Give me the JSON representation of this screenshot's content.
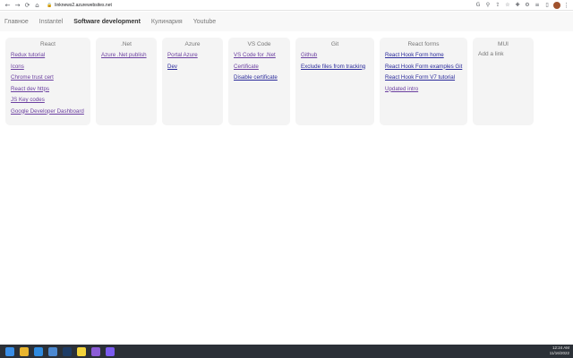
{
  "browser": {
    "url": "linknews2.azurewebsites.net",
    "nav": [
      "←",
      "→",
      "⟳",
      "⌂"
    ],
    "toolbar_icons": [
      {
        "name": "google-icon",
        "glyph": "G"
      },
      {
        "name": "search-icon",
        "glyph": "⚲"
      },
      {
        "name": "share-icon",
        "glyph": "⇪"
      },
      {
        "name": "star-icon",
        "glyph": "☆"
      },
      {
        "name": "extension-icon",
        "glyph": "✚"
      },
      {
        "name": "puzzle-icon",
        "glyph": "⚙"
      },
      {
        "name": "reading-list-icon",
        "glyph": "≡"
      },
      {
        "name": "sidebar-icon",
        "glyph": "▯"
      }
    ],
    "profile_color": "#a0522d"
  },
  "topnav": {
    "items": [
      "Главное",
      "Instantel",
      "Software development",
      "Кулинария",
      "Youtube"
    ],
    "active_index": 2
  },
  "cards": [
    {
      "title": "React",
      "width": 95,
      "links": [
        {
          "text": "Redux tutorial",
          "visited": true
        },
        {
          "text": "Icons",
          "visited": true
        },
        {
          "text": "Chrome trust cert",
          "visited": true
        },
        {
          "text": "React dev https",
          "visited": true
        },
        {
          "text": "JS Key codes",
          "visited": true
        },
        {
          "text": "Google Developer Dashboard",
          "visited": true
        }
      ]
    },
    {
      "title": ".Net",
      "width": 68,
      "links": [
        {
          "text": "Azure .Net publish",
          "visited": true
        }
      ]
    },
    {
      "title": "Azure",
      "width": 68,
      "links": [
        {
          "text": "Portal Azure",
          "visited": true
        },
        {
          "text": "Dev",
          "visited": false
        }
      ]
    },
    {
      "title": "VS Code",
      "width": 69,
      "links": [
        {
          "text": "VS Code for .Net",
          "visited": true
        },
        {
          "text": "Certificate",
          "visited": true
        },
        {
          "text": "Disable certificate",
          "visited": false
        }
      ]
    },
    {
      "title": "Git",
      "width": 88,
      "links": [
        {
          "text": "Github",
          "visited": true
        },
        {
          "text": "Exclude files from tracking",
          "visited": false
        }
      ]
    },
    {
      "title": "React forms",
      "width": 98,
      "links": [
        {
          "text": "React Hook Form home",
          "visited": false
        },
        {
          "text": "React Hook Form examples Git",
          "visited": false
        },
        {
          "text": "React Hook Form V7 tutorial",
          "visited": false
        },
        {
          "text": "Updated intro",
          "visited": true
        }
      ]
    },
    {
      "title": "MUI",
      "width": 68,
      "add_link": "Add a link",
      "links": []
    }
  ],
  "taskbar": {
    "apps": [
      {
        "name": "windows-start-icon",
        "color": "#3a8ee6"
      },
      {
        "name": "chrome-icon",
        "color": "#e8b52f"
      },
      {
        "name": "vscode-icon",
        "color": "#2f8be0"
      },
      {
        "name": "file-explorer-icon",
        "color": "#4b88d0"
      },
      {
        "name": "terminal-icon",
        "color": "#1e3c66"
      },
      {
        "name": "notes-icon",
        "color": "#f2d33b"
      },
      {
        "name": "visual-studio-icon",
        "color": "#8b5cd6"
      },
      {
        "name": "messenger-icon",
        "color": "#7b5cf0"
      }
    ],
    "time": "12:24 AM",
    "date": "11/16/2022"
  }
}
